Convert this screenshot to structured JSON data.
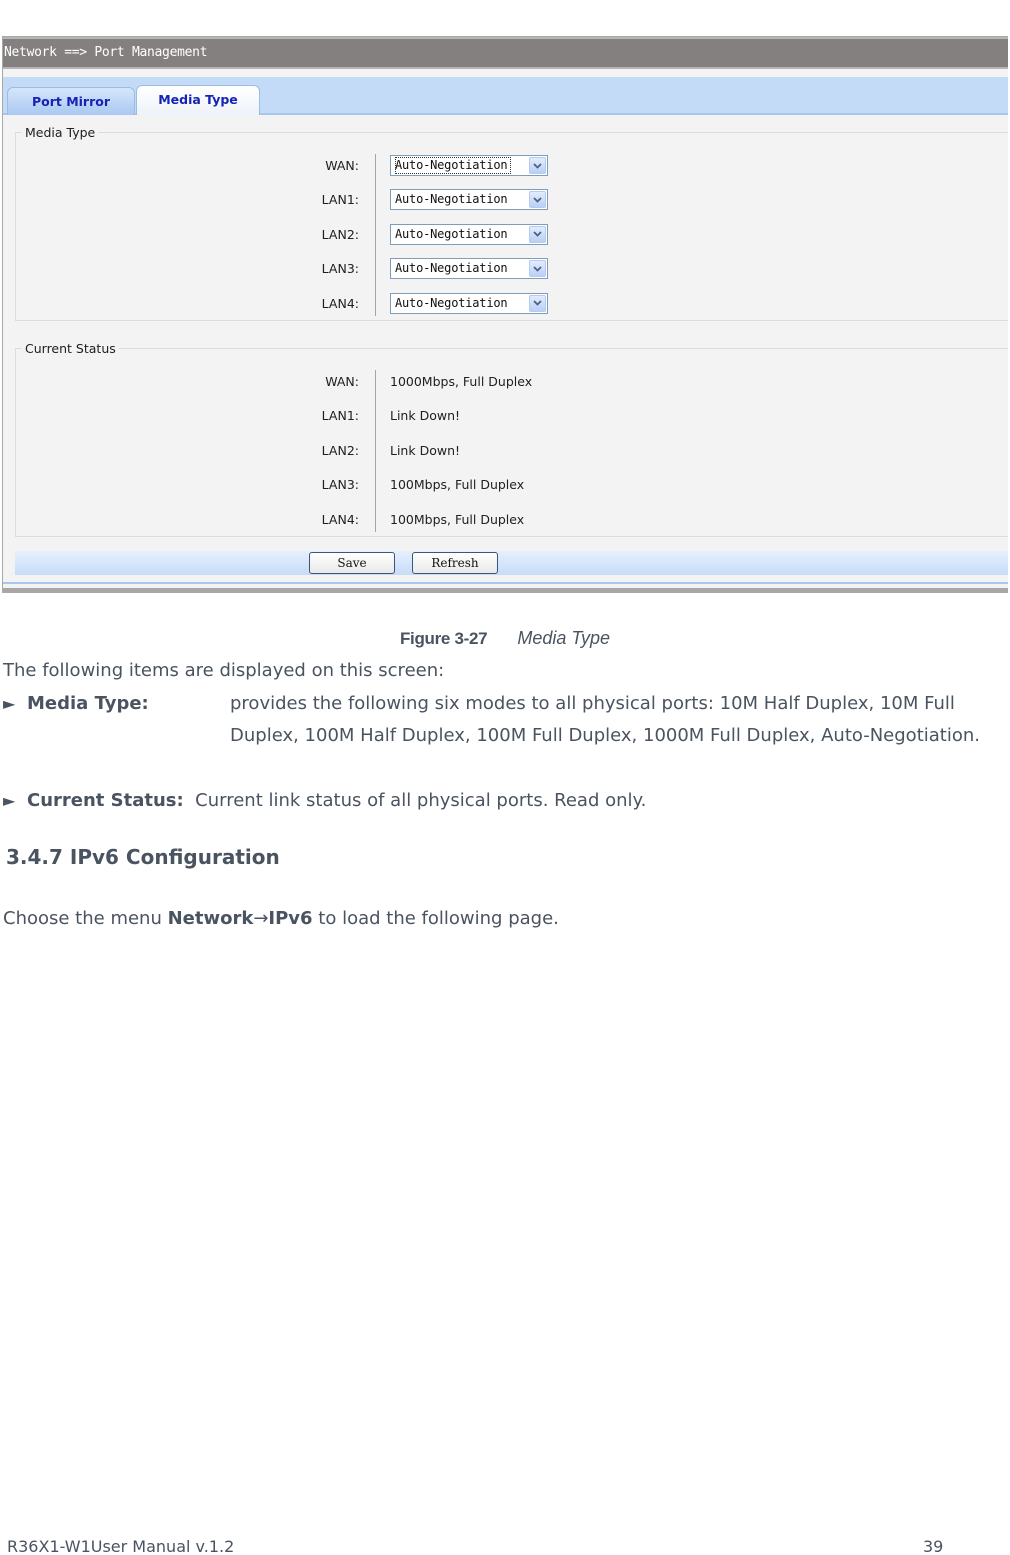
{
  "screenshot": {
    "breadcrumb": "Network ==> Port Management",
    "tabs": [
      {
        "label": "Port Mirror",
        "active": false
      },
      {
        "label": "Media Type",
        "active": true
      }
    ],
    "media_type_group": {
      "legend": "Media Type",
      "rows": [
        {
          "label": "WAN:",
          "value": "Auto-Negotiation"
        },
        {
          "label": "LAN1:",
          "value": "Auto-Negotiation"
        },
        {
          "label": "LAN2:",
          "value": "Auto-Negotiation"
        },
        {
          "label": "LAN3:",
          "value": "Auto-Negotiation"
        },
        {
          "label": "LAN4:",
          "value": "Auto-Negotiation"
        }
      ]
    },
    "current_status_group": {
      "legend": "Current Status",
      "rows": [
        {
          "label": "WAN:",
          "value": "1000Mbps, Full Duplex"
        },
        {
          "label": "LAN1:",
          "value": "Link Down!"
        },
        {
          "label": "LAN2:",
          "value": "Link Down!"
        },
        {
          "label": "LAN3:",
          "value": "100Mbps, Full Duplex"
        },
        {
          "label": "LAN4:",
          "value": "100Mbps, Full Duplex"
        }
      ]
    },
    "buttons": {
      "save": "Save",
      "refresh": "Refresh"
    }
  },
  "document": {
    "figure": {
      "number": "Figure 3-27",
      "title": "Media Type"
    },
    "intro": "The following items are displayed on this screen:",
    "items": [
      {
        "bullet": "►",
        "term": "Media Type:",
        "description": "provides the following six modes to all physical ports: 10M Half Duplex, 10M Full Duplex, 100M Half Duplex, 100M Full Duplex, 1000M Full Duplex, Auto-Negotiation."
      },
      {
        "bullet": "►",
        "term": "Current Status:",
        "description": "Current link status of all physical ports. Read only."
      }
    ],
    "section_heading": "3.4.7 IPv6 Configuration",
    "choose": {
      "prefix": "Choose the menu ",
      "menu_path_1": "Network",
      "arrow": "→",
      "menu_path_2": "IPv6",
      "suffix": " to load the following page."
    }
  },
  "footer": {
    "manual": "R36X1-W1User Manual v.1.2",
    "page_number": "39"
  }
}
